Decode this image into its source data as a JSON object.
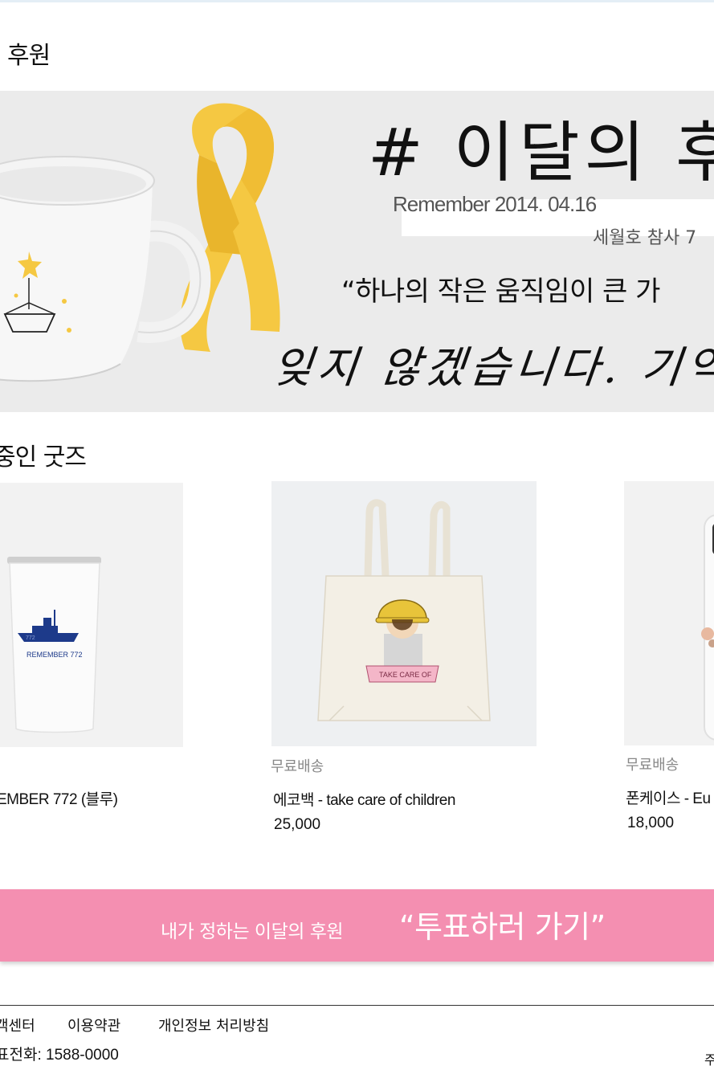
{
  "page": {
    "title": "후원"
  },
  "banner": {
    "title": "# 이달의 후",
    "remember_text": "Remember 2014. 04.16",
    "subtitle": "세월호 참사 7",
    "quote": "“하나의 작은 움직임이 큰 가",
    "handwriting": "잊지 않겠습니다. 기억하겠"
  },
  "goods": {
    "section_title": "중인 굿즈",
    "items": [
      {
        "badge": "",
        "name": "EMBER 772 (블루)",
        "price": "",
        "image": "tumbler",
        "image_text": "REMEMBER 772",
        "image_ship_text": "772"
      },
      {
        "badge": "무료배송",
        "name": "에코백 - take care of children",
        "price": "25,000",
        "image": "eco-bag",
        "image_text": "TAKE CARE OF"
      },
      {
        "badge": "무료배송",
        "name": "폰케이스 - Eu",
        "price": "18,000",
        "image": "phone-case",
        "image_text": ""
      }
    ]
  },
  "vote": {
    "lead": "내가 정하는 이달의 후원",
    "cta": "“투표하러 가기”"
  },
  "footer": {
    "links": [
      "객센터",
      "이용약관",
      "개인정보 처리방침"
    ],
    "phone": "표전화: 1588-0000",
    "right_text": "주"
  },
  "colors": {
    "accent_pink": "#f48fb1",
    "ribbon_yellow": "#f5c842",
    "banner_bg": "#ebebeb",
    "tumbler_ship_blue": "#1d3a8a"
  }
}
